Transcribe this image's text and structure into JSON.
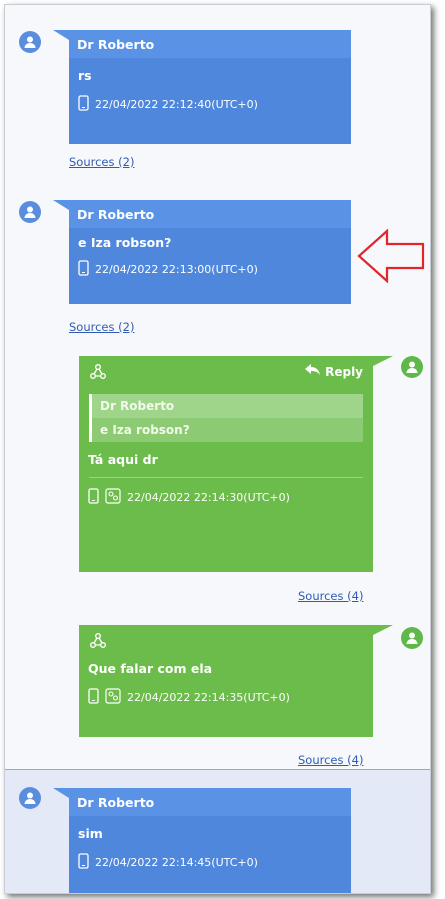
{
  "messages": [
    {
      "sender": "Dr Roberto",
      "text": "rs",
      "timestamp": "22/04/2022 22:12:40(UTC+0)",
      "sources": "Sources (2)"
    },
    {
      "sender": "Dr Roberto",
      "text": "e Iza robson?",
      "timestamp": "22/04/2022 22:13:00(UTC+0)",
      "sources": "Sources (2)"
    },
    {
      "reply_label": "Reply",
      "quote_sender": "Dr Roberto",
      "quote_text": "e Iza robson?",
      "text": "Tá aqui dr",
      "timestamp": "22/04/2022 22:14:30(UTC+0)",
      "sources": "Sources (4)"
    },
    {
      "text": "Que falar com ela",
      "timestamp": "22/04/2022 22:14:35(UTC+0)",
      "sources": "Sources (4)"
    },
    {
      "sender": "Dr Roberto",
      "text": "sim",
      "timestamp": "22/04/2022 22:14:45(UTC+0)"
    }
  ],
  "colors": {
    "incoming": "#4f87dd",
    "outgoing": "#6bbc4a",
    "arrow": "#e0252b"
  }
}
